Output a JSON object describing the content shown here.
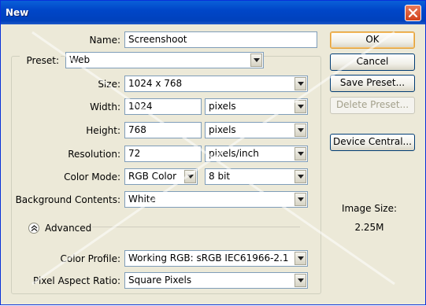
{
  "window": {
    "title": "New",
    "close_icon": "close-icon"
  },
  "form": {
    "name_label": "Name:",
    "name_value": "Screenshoot",
    "preset_label": "Preset:",
    "preset_value": "Web",
    "size_label": "Size:",
    "size_value": "1024 x 768",
    "width_label": "Width:",
    "width_value": "1024",
    "width_unit": "pixels",
    "height_label": "Height:",
    "height_value": "768",
    "height_unit": "pixels",
    "resolution_label": "Resolution:",
    "resolution_value": "72",
    "resolution_unit": "pixels/inch",
    "color_mode_label": "Color Mode:",
    "color_mode_value": "RGB Color",
    "bit_depth_value": "8 bit",
    "background_label": "Background Contents:",
    "background_value": "White",
    "advanced_label": "Advanced",
    "color_profile_label": "Color Profile:",
    "color_profile_value": "Working RGB:  sRGB IEC61966-2.1",
    "pixel_aspect_label": "Pixel Aspect Ratio:",
    "pixel_aspect_value": "Square Pixels"
  },
  "buttons": {
    "ok": "OK",
    "cancel": "Cancel",
    "save_preset": "Save Preset...",
    "delete_preset": "Delete Preset...",
    "device_central": "Device Central..."
  },
  "info": {
    "image_size_label": "Image Size:",
    "image_size_value": "2.25M"
  },
  "colors": {
    "titlebar": "#0046c8",
    "dialog_bg": "#ece9d8",
    "default_button_border": "#e0a03a"
  }
}
